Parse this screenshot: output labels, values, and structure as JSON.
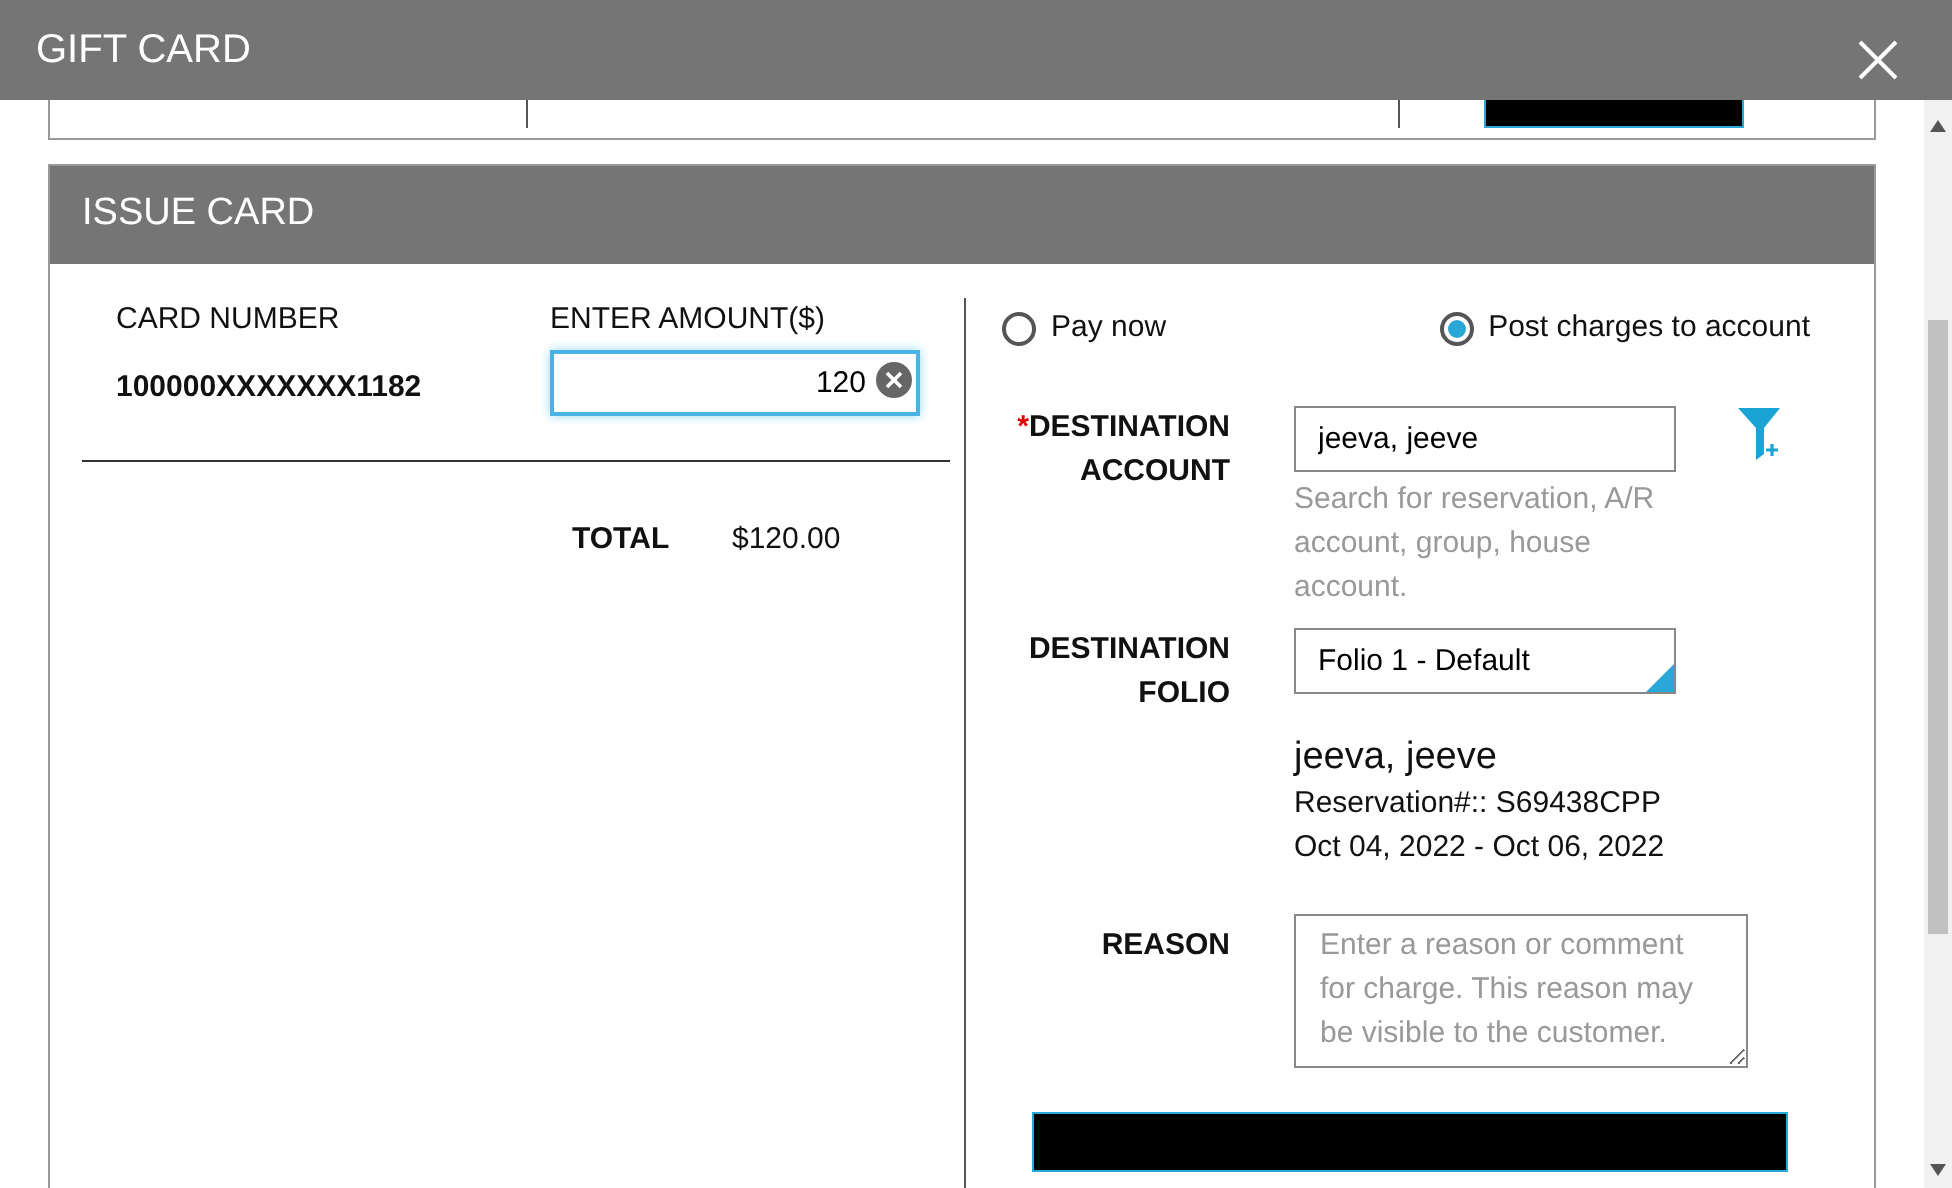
{
  "dialog": {
    "title": "GIFT CARD"
  },
  "issue_card": {
    "title": "ISSUE CARD",
    "card_number_label": "CARD NUMBER",
    "amount_label": "ENTER AMOUNT($)",
    "card_number": "100000XXXXXXX1182",
    "amount": "120",
    "total_label": "TOTAL",
    "total": "$120.00"
  },
  "payment_options": [
    {
      "label": "Pay now",
      "selected": false
    },
    {
      "label": "Post charges to account",
      "selected": true
    }
  ],
  "destination_account": {
    "required_mark": "*",
    "label": "DESTINATION ACCOUNT",
    "value": "jeeva, jeeve",
    "hint": "Search for reservation, A/R account, group, house account."
  },
  "destination_folio": {
    "label": "DESTINATION FOLIO",
    "value": "Folio 1 - Default"
  },
  "guest": {
    "name": "jeeva, jeeve",
    "reservation": "Reservation#:: S69438CPP",
    "dates": "Oct 04, 2022 - Oct 06, 2022"
  },
  "reason": {
    "label": "REASON",
    "placeholder": "Enter a reason or comment for charge. This reason may be visible to the customer."
  }
}
